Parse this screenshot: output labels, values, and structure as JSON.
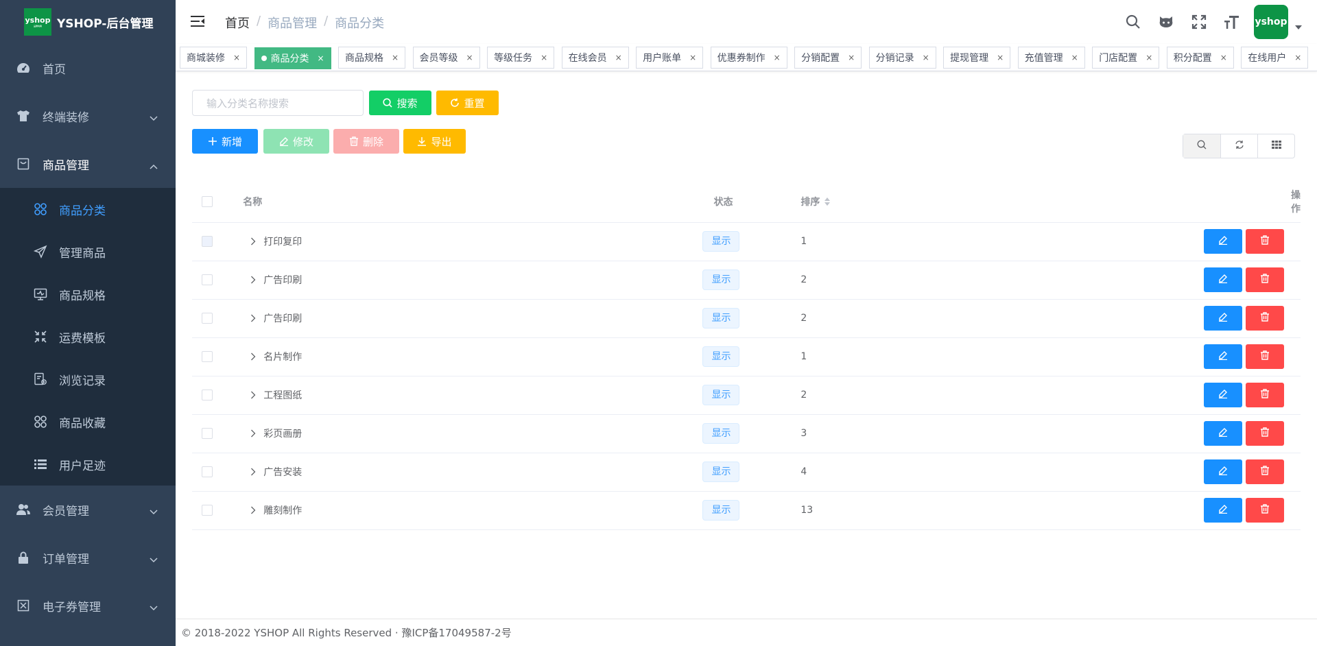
{
  "app": {
    "logo_text": "yshop",
    "logo_sub": "品牌电商",
    "title": "YSHOP-后台管理"
  },
  "sidebar": {
    "items": [
      {
        "label": "首页",
        "icon": "dashboard-icon"
      },
      {
        "label": "终端装修",
        "icon": "shirt-icon"
      },
      {
        "label": "商品管理",
        "icon": "shop-icon"
      },
      {
        "label": "会员管理",
        "icon": "peoples-icon"
      },
      {
        "label": "订单管理",
        "icon": "lock-icon"
      },
      {
        "label": "电子券管理",
        "icon": "coupon-icon"
      }
    ],
    "sub_items": [
      {
        "label": "商品分类",
        "icon": "category-icon",
        "active": true
      },
      {
        "label": "管理商品",
        "icon": "send-icon"
      },
      {
        "label": "商品规格",
        "icon": "monitor-icon"
      },
      {
        "label": "运费模板",
        "icon": "compress-icon"
      },
      {
        "label": "浏览记录",
        "icon": "log-icon"
      },
      {
        "label": "商品收藏",
        "icon": "category-icon"
      },
      {
        "label": "用户足迹",
        "icon": "list-icon"
      }
    ]
  },
  "breadcrumb": [
    "首页",
    "商品管理",
    "商品分类"
  ],
  "tags": [
    {
      "label": "商城装修"
    },
    {
      "label": "商品分类",
      "active": true
    },
    {
      "label": "商品规格"
    },
    {
      "label": "会员等级"
    },
    {
      "label": "等级任务"
    },
    {
      "label": "在线会员"
    },
    {
      "label": "用户账单"
    },
    {
      "label": "优惠券制作"
    },
    {
      "label": "分销配置"
    },
    {
      "label": "分销记录"
    },
    {
      "label": "提现管理"
    },
    {
      "label": "充值管理"
    },
    {
      "label": "门店配置"
    },
    {
      "label": "积分配置"
    },
    {
      "label": "在线用户"
    }
  ],
  "search": {
    "placeholder": "输入分类名称搜索",
    "search_label": "搜索",
    "reset_label": "重置"
  },
  "toolbar": {
    "add": "新增",
    "edit": "修改",
    "delete": "删除",
    "export": "导出"
  },
  "table": {
    "headers": {
      "name": "名称",
      "status": "状态",
      "sort": "排序",
      "ops": "操作"
    },
    "rows": [
      {
        "name": "打印复印",
        "status": "显示",
        "sort": "1"
      },
      {
        "name": "广告印刷",
        "status": "显示",
        "sort": "2"
      },
      {
        "name": "广告印刷",
        "status": "显示",
        "sort": "2"
      },
      {
        "name": "名片制作",
        "status": "显示",
        "sort": "1"
      },
      {
        "name": "工程图纸",
        "status": "显示",
        "sort": "2"
      },
      {
        "name": "彩页画册",
        "status": "显示",
        "sort": "3"
      },
      {
        "name": "广告安装",
        "status": "显示",
        "sort": "4"
      },
      {
        "name": "雕刻制作",
        "status": "显示",
        "sort": "13"
      }
    ]
  },
  "footer": "© 2018-2022 YSHOP All Rights Reserved · 豫ICP备17049587-2号",
  "colors": {
    "sidebar": "#304156",
    "submenu": "#1f2d3d",
    "primary": "#1890ff",
    "success": "#13ce66",
    "warning": "#ffba00",
    "danger": "#ff4949",
    "active_tag": "#42b983"
  }
}
